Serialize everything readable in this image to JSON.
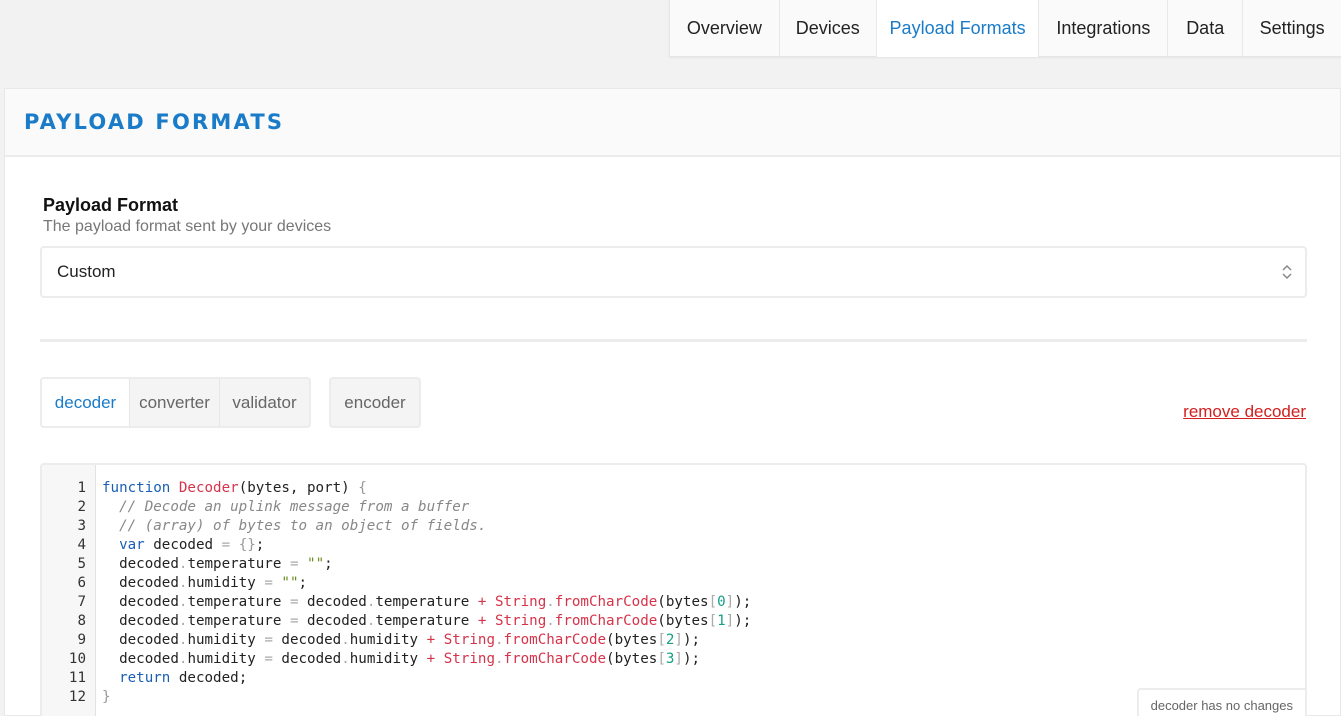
{
  "top_tabs": [
    {
      "label": "Overview",
      "width": 110
    },
    {
      "label": "Devices",
      "width": 97
    },
    {
      "label": "Payload Formats",
      "width": 163
    },
    {
      "label": "Integrations",
      "width": 129
    },
    {
      "label": "Data",
      "width": 75
    },
    {
      "label": "Settings",
      "width": 98
    }
  ],
  "page": {
    "title": "PAYLOAD FORMATS"
  },
  "payload_format": {
    "label": "Payload Format",
    "help": "The payload format sent by your devices",
    "selected": "Custom"
  },
  "sub_tabs": {
    "decoder": "decoder",
    "converter": "converter",
    "validator": "validator",
    "encoder": "encoder"
  },
  "remove_link": "remove decoder",
  "status": "decoder has no changes",
  "code_lines": [
    "1",
    "2",
    "3",
    "4",
    "5",
    "6",
    "7",
    "8",
    "9",
    "10",
    "11",
    "12"
  ],
  "code_tokens": {
    "function": "function",
    "decoder_fn": "Decoder",
    "params": "(bytes, port) ",
    "open_brace": "{",
    "close_brace": "}",
    "comment1": "// Decode an uplink message from a buffer",
    "comment2": "// (array) of bytes to an object of fields.",
    "var": "var",
    "decoded": "decoded",
    "temperature": "temperature",
    "humidity": "humidity",
    "string": "String",
    "fromCharCode": "fromCharCode",
    "bytes": "bytes",
    "return": "return",
    "empty_str": "\"\"",
    "n0": "0",
    "n1": "1",
    "n2": "2",
    "n3": "3"
  }
}
